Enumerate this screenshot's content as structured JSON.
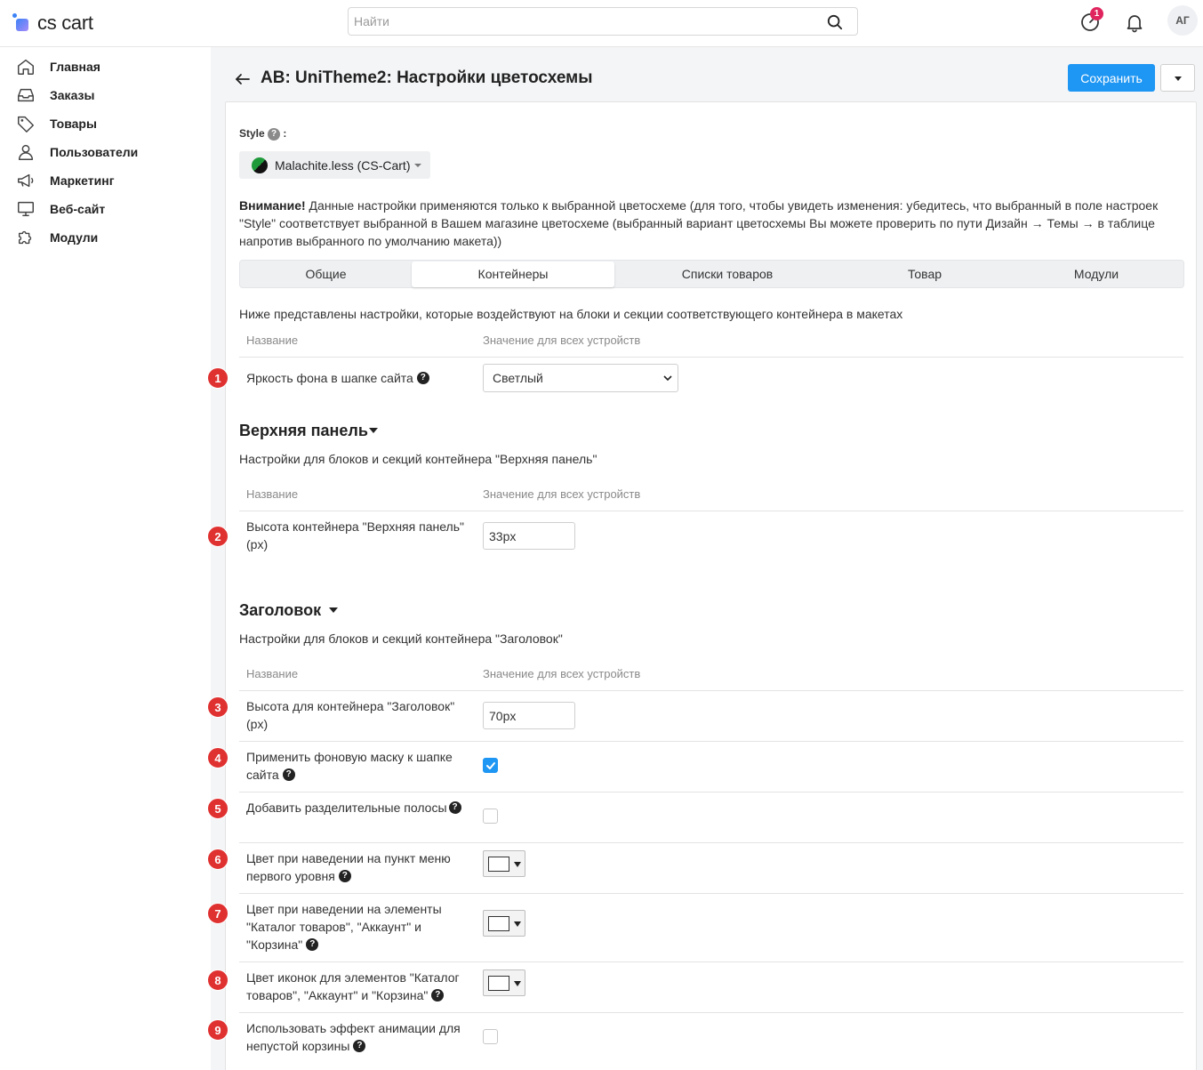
{
  "app": {
    "logo_text": "cs cart"
  },
  "search": {
    "placeholder": "Найти",
    "value": ""
  },
  "header": {
    "notification_count": "1",
    "avatar_initials": "АГ"
  },
  "sidebar": {
    "items": [
      {
        "label": "Главная",
        "icon": "home-icon"
      },
      {
        "label": "Заказы",
        "icon": "inbox-icon"
      },
      {
        "label": "Товары",
        "icon": "tag-icon"
      },
      {
        "label": "Пользователи",
        "icon": "user-icon"
      },
      {
        "label": "Маркетинг",
        "icon": "megaphone-icon"
      },
      {
        "label": "Веб-сайт",
        "icon": "monitor-icon"
      },
      {
        "label": "Модули",
        "icon": "puzzle-icon"
      }
    ]
  },
  "page": {
    "title": "AB: UniTheme2: Настройки цветосхемы",
    "save_label": "Сохранить",
    "style_label": "Style",
    "style_value": "Malachite.less (CS-Cart)",
    "notice_bold": "Внимание!",
    "notice_text": " Данные настройки применяются только к выбранной цветосхеме (для того, чтобы увидеть изменения: убедитесь, что выбранный в поле настроек \"Style\" соответствует выбранной в Вашем магазине цветосхеме (выбранный вариант цветосхемы Вы можете проверить по пути Дизайн → Темы → в таблице напротив выбранного по умолчанию макета))",
    "tabs": [
      {
        "label": "Общие",
        "active": false
      },
      {
        "label": "Контейнеры",
        "active": true
      },
      {
        "label": "Списки товаров",
        "active": false
      },
      {
        "label": "Товар",
        "active": false
      },
      {
        "label": "Модули",
        "active": false
      }
    ],
    "intro": "Ниже представлены настройки, которые воздействуют на блоки и секции соответствующего контейнера в макетах",
    "col_name": "Название",
    "col_value": "Значение для всех устройств"
  },
  "general": {
    "row1": {
      "marker": "1",
      "label": "Яркость фона в шапке сайта",
      "value": "Светлый"
    }
  },
  "top_panel": {
    "title": "Верхняя панель",
    "desc": "Настройки для блоков и секций контейнера \"Верхняя панель\"",
    "row2": {
      "marker": "2",
      "label": "Высота контейнера \"Верхняя панель\" (px)",
      "value": "33px"
    }
  },
  "header_section": {
    "title": "Заголовок",
    "desc": "Настройки для блоков и секций контейнера \"Заголовок\"",
    "row3": {
      "marker": "3",
      "label": "Высота для контейнера \"Заголовок\" (px)",
      "value": "70px"
    },
    "row4": {
      "marker": "4",
      "label": "Применить фоновую маску к шапке сайта",
      "checked": true
    },
    "row5": {
      "marker": "5",
      "label": "Добавить разделительные полосы",
      "checked": false
    },
    "row6": {
      "marker": "6",
      "label": "Цвет при наведении на пункт меню первого уровня",
      "color": "#ffffff"
    },
    "row7": {
      "marker": "7",
      "label": "Цвет при наведении на элементы \"Каталог товаров\", \"Аккаунт\" и \"Корзина\"",
      "color": "#ffffff"
    },
    "row8": {
      "marker": "8",
      "label": "Цвет иконок для элементов \"Каталог товаров\", \"Аккаунт\" и \"Корзина\"",
      "color": "#ffffff"
    },
    "row9": {
      "marker": "9",
      "label": "Использовать эффект анимации для непустой корзины",
      "checked": false
    }
  },
  "colors": {
    "accent": "#1e96f3",
    "marker": "#e03131",
    "badge": "#e0245e"
  }
}
